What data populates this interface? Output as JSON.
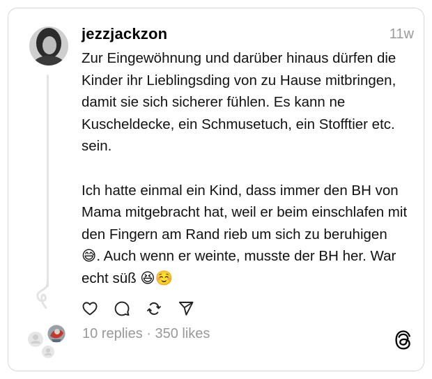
{
  "post": {
    "username": "jezzjackzon",
    "timestamp": "11w",
    "text": "Zur Eingewöhnung und darüber hinaus dürfen die Kinder ihr Lieblingsding von zu Hause mitbringen, damit sie sich sicherer fühlen. Es kann ne Kuscheldecke, ein Schmusetuch, ein Stofftier etc. sein.\n\nIch hatte einmal ein Kind, dass immer den BH von Mama mitgebracht hat, weil er beim einschlafen mit den Fingern am Rand rieb um sich zu beruhigen 😅. Auch wenn er weinte, musste der BH her. War echt süß 😆☺️",
    "stats": "10 replies · 350 likes"
  },
  "icons": {
    "like": "heart-icon",
    "comment": "comment-icon",
    "repost": "repost-icon",
    "share": "send-icon",
    "brand": "threads-logo-icon"
  },
  "colors": {
    "text": "#111111",
    "muted": "#999999",
    "border": "#d8d8d8",
    "thread_line": "#e3e3e3"
  }
}
